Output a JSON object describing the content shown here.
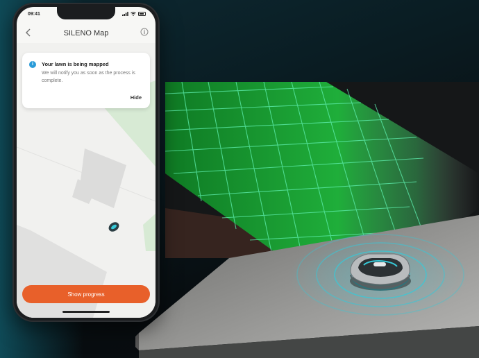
{
  "status_bar": {
    "time": "09:41"
  },
  "nav": {
    "title": "SILENO Map"
  },
  "notification": {
    "title": "Your lawn is being mapped",
    "body": "We will notify you as soon as the process is complete.",
    "hide_label": "Hide"
  },
  "cta": {
    "label": "Show progress"
  },
  "icons": {
    "back": "chevron-left-icon",
    "info": "info-icon",
    "notice": "info-icon",
    "robot": "robot-mower-icon"
  },
  "colors": {
    "accent": "#e8602a",
    "info_blue": "#2a9bd8",
    "lawn_green": "#1fae3a",
    "grid_line": "#5ff0b0",
    "signal_cyan": "#37c9d8"
  }
}
